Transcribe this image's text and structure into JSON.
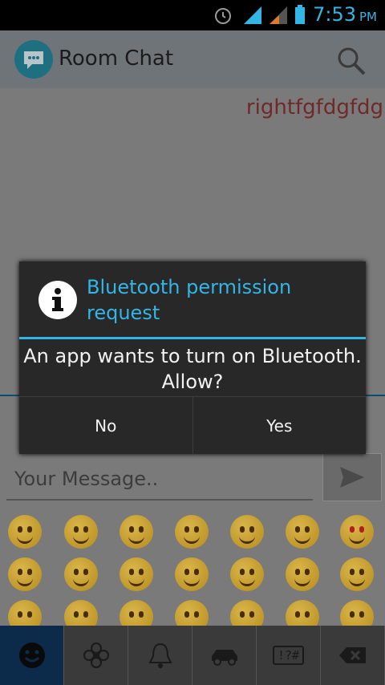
{
  "status_bar": {
    "time": "7:53",
    "ampm": "PM",
    "icons": [
      "alarm-icon",
      "signal-icon",
      "signal-icon-2",
      "battery-icon"
    ]
  },
  "app_bar": {
    "title": "Room Chat",
    "logo_icon": "chat-bubble-icon",
    "search_icon": "search-icon"
  },
  "chat": {
    "messages": [
      "rightfgfdgfdg"
    ]
  },
  "composer": {
    "placeholder": "Your Message..",
    "send_icon": "send-icon"
  },
  "emoji_keyboard": {
    "tabs": [
      {
        "icon": "smiley-icon",
        "label": ""
      },
      {
        "icon": "flower-icon",
        "label": ""
      },
      {
        "icon": "bell-icon",
        "label": ""
      },
      {
        "icon": "car-icon",
        "label": ""
      },
      {
        "icon": "symbols-icon",
        "label": "!?#"
      },
      {
        "icon": "backspace-icon",
        "label": ""
      }
    ]
  },
  "dialog": {
    "icon": "info-icon",
    "title": "Bluetooth permission request",
    "message": "An app wants to turn on Bluetooth. Allow?",
    "buttons": {
      "no": "No",
      "yes": "Yes"
    }
  },
  "colors": {
    "accent": "#33b5e5",
    "dialog_bg": "#282828",
    "message_text": "#6e2a2a"
  }
}
